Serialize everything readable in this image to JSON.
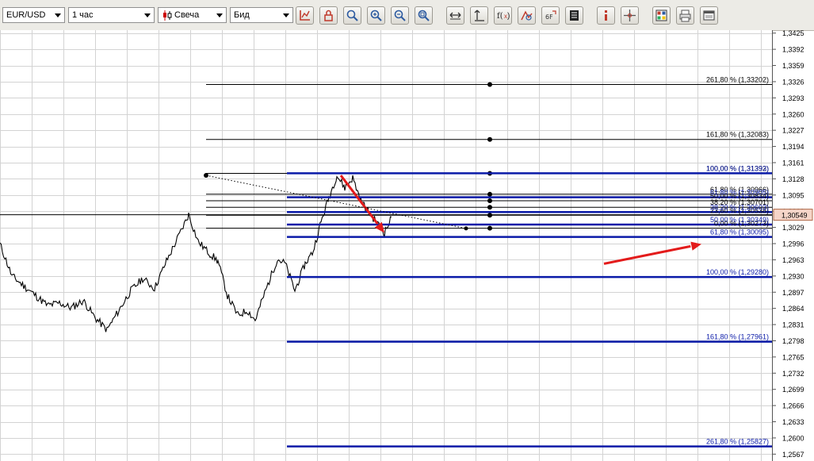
{
  "toolbar": {
    "symbol": "EUR/USD",
    "timeframe": "1 час",
    "chart_type": "Свеча",
    "price_type": "Бид",
    "buttons": [
      {
        "name": "chart-settings-icon",
        "color": "#c0392b"
      },
      {
        "name": "lock-icon",
        "color": "#c0392b"
      },
      {
        "name": "zoom-icon",
        "color": "#2c5aa0"
      },
      {
        "name": "zoom-in-icon",
        "color": "#2c5aa0"
      },
      {
        "name": "zoom-out-icon",
        "color": "#2c5aa0"
      },
      {
        "name": "zoom-fit-icon",
        "color": "#2c5aa0"
      },
      {
        "name": "horizontal-scale-icon",
        "color": "#333333"
      },
      {
        "name": "vertical-scale-icon",
        "color": "#333333"
      },
      {
        "name": "indicator-fx-icon",
        "color": "#c0392b"
      },
      {
        "name": "shapes-icon",
        "color": "#c0392b"
      },
      {
        "name": "gf-tool-icon",
        "color": "#333333"
      },
      {
        "name": "notepad-icon",
        "color": "#222222"
      },
      {
        "name": "info-icon",
        "color": "#c0392b"
      },
      {
        "name": "crosshair-icon",
        "color": "#555555"
      },
      {
        "name": "grid-layout-icon",
        "color": "#2c5aa0"
      },
      {
        "name": "print-icon",
        "color": "#555555"
      },
      {
        "name": "window-icon",
        "color": "#555555"
      }
    ]
  },
  "chart_data": {
    "type": "candlestick",
    "grid": true,
    "y_axis_side": "right",
    "ylim": [
      1.2553,
      1.3431
    ],
    "y_ticks": [
      1.3425,
      1.3392,
      1.3359,
      1.3326,
      1.3293,
      1.326,
      1.3227,
      1.3194,
      1.3161,
      1.3128,
      1.3095,
      1.3062,
      1.3029,
      1.2996,
      1.2963,
      1.293,
      1.2897,
      1.2864,
      1.2831,
      1.2798,
      1.2765,
      1.2732,
      1.2699,
      1.2666,
      1.2633,
      1.26,
      1.2567
    ],
    "y_tick_labels": [
      "1,3425",
      "1,3392",
      "1,3359",
      "1,3326",
      "1,3293",
      "1,3260",
      "1,3227",
      "1,3194",
      "1,3161",
      "1,3128",
      "1,3095",
      "1,3062",
      "1,3029",
      "1,2996",
      "1,2963",
      "1,2930",
      "1,2897",
      "1,2864",
      "1,2831",
      "1,2798",
      "1,2765",
      "1,2732",
      "1,2699",
      "1,2666",
      "1,2633",
      "1,2600",
      "1,2567"
    ],
    "current_price": 1.30549,
    "current_price_label": "1,30549",
    "price_path": [
      [
        0,
        1.2995
      ],
      [
        15,
        1.293
      ],
      [
        30,
        1.291
      ],
      [
        45,
        1.289
      ],
      [
        60,
        1.287
      ],
      [
        75,
        1.2875
      ],
      [
        90,
        1.2865
      ],
      [
        105,
        1.288
      ],
      [
        120,
        1.2845
      ],
      [
        135,
        1.282
      ],
      [
        150,
        1.286
      ],
      [
        165,
        1.29
      ],
      [
        180,
        1.2925
      ],
      [
        195,
        1.2905
      ],
      [
        210,
        1.296
      ],
      [
        225,
        1.301
      ],
      [
        238,
        1.3055
      ],
      [
        250,
        1.3
      ],
      [
        262,
        1.298
      ],
      [
        275,
        1.296
      ],
      [
        287,
        1.289
      ],
      [
        300,
        1.285
      ],
      [
        312,
        1.286
      ],
      [
        322,
        1.284
      ],
      [
        335,
        1.29
      ],
      [
        350,
        1.2965
      ],
      [
        360,
        1.2955
      ],
      [
        372,
        1.29
      ],
      [
        385,
        1.2955
      ],
      [
        395,
        1.298
      ],
      [
        405,
        1.304
      ],
      [
        415,
        1.309
      ],
      [
        425,
        1.3135
      ],
      [
        435,
        1.311
      ],
      [
        445,
        1.313
      ],
      [
        455,
        1.3085
      ],
      [
        465,
        1.306
      ],
      [
        475,
        1.304
      ],
      [
        485,
        1.3018
      ],
      [
        495,
        1.3052
      ]
    ],
    "fib_sets": [
      {
        "name": "fibonacci-projection-upper",
        "color": "#000000",
        "anchors": [
          [
            260,
            1.3135
          ],
          [
            618,
            1.3135
          ]
        ],
        "levels": [
          {
            "label": "261,80 % (1,33202)",
            "value": 1.33202
          },
          {
            "label": "161,80 % (1,32083)",
            "value": 1.32083
          },
          {
            "label": "100,00 % (1,31392)",
            "value": 1.31392
          },
          {
            "label": "61,80 % (1,30966)",
            "value": 1.30966
          },
          {
            "label": "50,00 % (1,30834)",
            "value": 1.30834
          },
          {
            "label": "38,20 % (1,30701)",
            "value": 1.30701
          },
          {
            "label": "23,60 % (1,30538)",
            "value": 1.30538
          },
          {
            "label": "0,00 % (1,30273)",
            "value": 1.30273
          }
        ]
      },
      {
        "name": "fibonacci-projection-lower",
        "color": "#0a1aa8",
        "levels": [
          {
            "label": "100,00 % (1,31393)",
            "value": 1.31393
          },
          {
            "label": "61,80 % (1,30905)",
            "value": 1.30905
          },
          {
            "label": "38,20 % (1,30603)",
            "value": 1.30603
          },
          {
            "label": "50,00 % (1,30349)",
            "value": 1.30349
          },
          {
            "label": "61,80 % (1,30095)",
            "value": 1.30095
          },
          {
            "label": "100,00 % (1,29280)",
            "value": 1.2928
          },
          {
            "label": "161,80 % (1,27961)",
            "value": 1.27961
          },
          {
            "label": "261,80 % (1,25827)",
            "value": 1.25827
          }
        ]
      }
    ],
    "annotations": [
      {
        "type": "arrow",
        "color": "#e31b1b",
        "from": [
          430,
          1.3135
        ],
        "to": [
          485,
          1.3018
        ]
      },
      {
        "type": "arrow",
        "color": "#e31b1b",
        "from": [
          762,
          1.2955
        ],
        "to": [
          885,
          1.2995
        ]
      },
      {
        "type": "trendline-dotted",
        "color": "#000000",
        "from": [
          260,
          1.3135
        ],
        "to": [
          588,
          1.3027
        ]
      }
    ]
  }
}
